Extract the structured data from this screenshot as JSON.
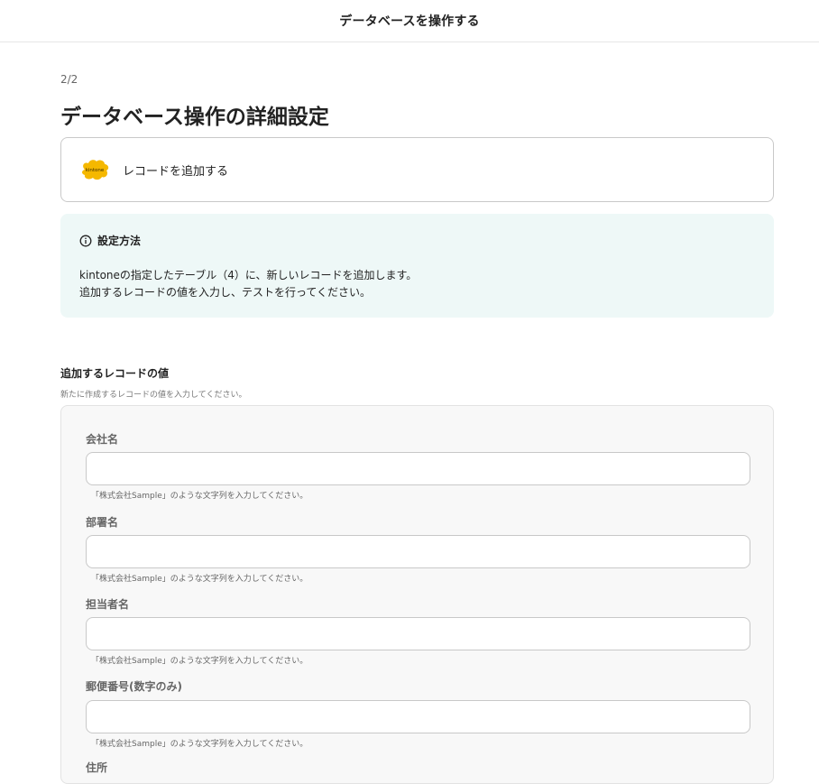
{
  "header": {
    "title": "データベースを操作する"
  },
  "step": "2/2",
  "page_title": "データベース操作の詳細設定",
  "app_card": {
    "logo_text": "kintone",
    "logo_color": "#F5B800",
    "action": "レコードを追加する"
  },
  "info": {
    "heading": "設定方法",
    "line1": "kintoneの指定したテーブル（4）に、新しいレコードを追加します。",
    "line2": "追加するレコードの値を入力し、テストを行ってください。",
    "background": "#EEF8F7"
  },
  "section": {
    "title": "追加するレコードの値",
    "description": "新たに作成するレコードの値を入力してください。"
  },
  "fields": [
    {
      "label": "会社名",
      "value": "",
      "help": "「株式会社Sample」のような文字列を入力してください。"
    },
    {
      "label": "部署名",
      "value": "",
      "help": "「株式会社Sample」のような文字列を入力してください。"
    },
    {
      "label": "担当者名",
      "value": "",
      "help": "「株式会社Sample」のような文字列を入力してください。"
    },
    {
      "label": "郵便番号(数字のみ)",
      "value": "",
      "help": "「株式会社Sample」のような文字列を入力してください。"
    },
    {
      "label": "住所",
      "value": "",
      "help": ""
    }
  ]
}
